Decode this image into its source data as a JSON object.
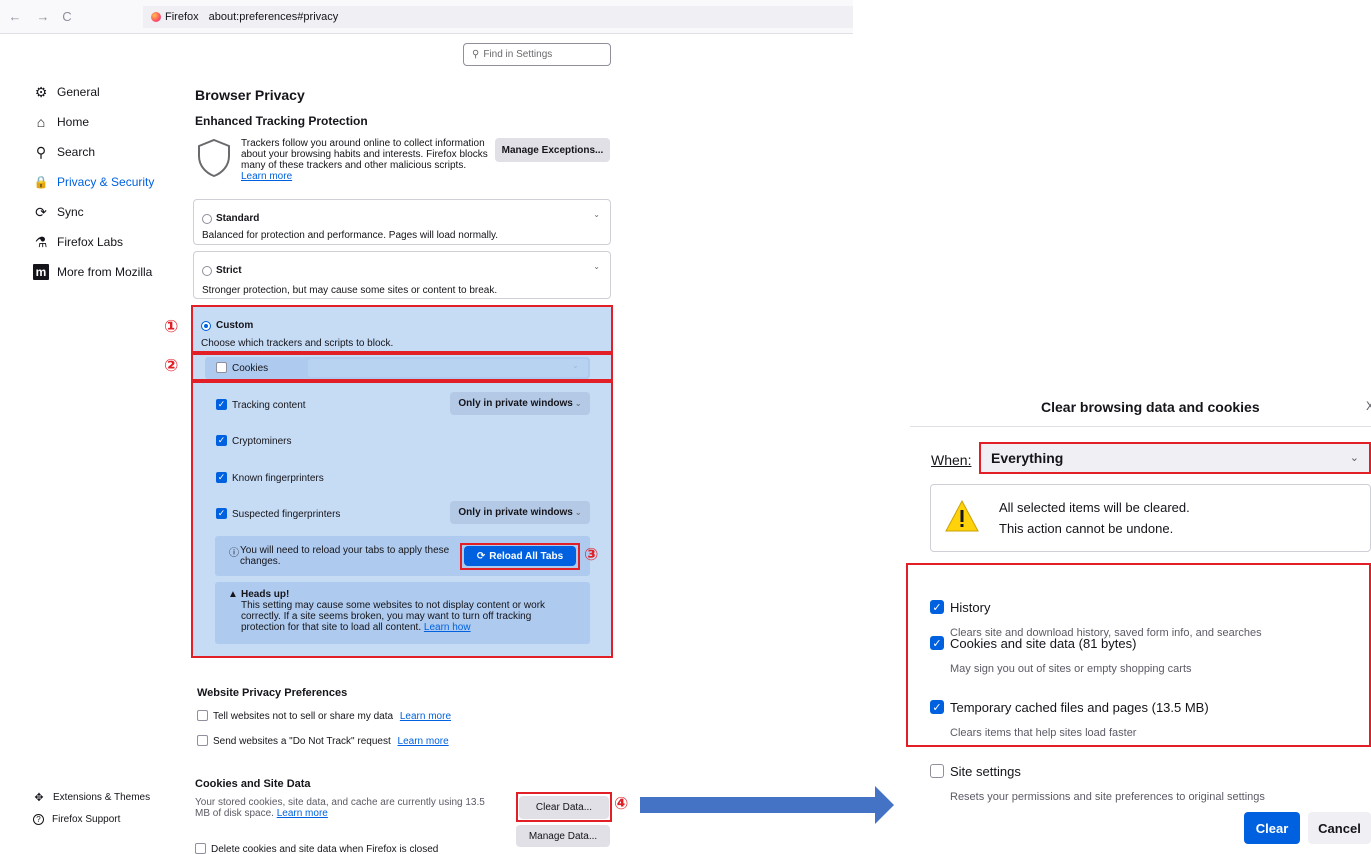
{
  "browser": {
    "back": "←",
    "forward": "→",
    "reload": "C",
    "browser_name": "Firefox",
    "url": "about:preferences#privacy"
  },
  "sidebar": {
    "items": [
      {
        "label": "General",
        "icon": "⚙"
      },
      {
        "label": "Home",
        "icon": "⌂"
      },
      {
        "label": "Search",
        "icon": "⚲"
      },
      {
        "label": "Privacy & Security",
        "icon": "🔒"
      },
      {
        "label": "Sync",
        "icon": "⟳"
      },
      {
        "label": "Firefox Labs",
        "icon": "⚗"
      },
      {
        "label": "More from Mozilla",
        "icon": "m"
      }
    ],
    "footer": [
      {
        "label": "Extensions & Themes",
        "icon": "✥"
      },
      {
        "label": "Firefox Support",
        "icon": "?"
      }
    ]
  },
  "search": {
    "placeholder": "Find in Settings"
  },
  "privacy": {
    "title": "Browser Privacy",
    "etp_title": "Enhanced Tracking Protection",
    "etp_desc": "Trackers follow you around online to collect information about your browsing habits and interests. Firefox blocks many of these trackers and other malicious scripts.",
    "learn_more": "Learn more",
    "manage_exceptions": "Manage Exceptions...",
    "standard": {
      "label": "Standard",
      "desc": "Balanced for protection and performance. Pages will load normally."
    },
    "strict": {
      "label": "Strict",
      "desc": "Stronger protection, but may cause some sites or content to break."
    },
    "custom": {
      "label": "Custom",
      "desc": "Choose which trackers and scripts to block."
    },
    "options": {
      "cookies": "Cookies",
      "tracking": "Tracking content",
      "cryptominers": "Cryptominers",
      "known_fp": "Known fingerprinters",
      "suspected_fp": "Suspected fingerprinters",
      "only_private": "Only in private windows"
    },
    "reload_notice": "You will need to reload your tabs to apply these changes.",
    "reload_button": "Reload All Tabs",
    "headsup_title": "Heads up!",
    "headsup_text": "This setting may cause some websites to not display content or work correctly. If a site seems broken, you may want to turn off tracking protection for that site to load all content.",
    "learn_how": "Learn how"
  },
  "website_prefs": {
    "title": "Website Privacy Preferences",
    "sell": "Tell websites not to sell or share my data",
    "dnt": "Send websites a \"Do Not Track\" request",
    "learn_more": "Learn more"
  },
  "cookies_section": {
    "title": "Cookies and Site Data",
    "desc": "Your stored cookies, site data, and cache are currently using 13.5 MB of disk space.",
    "learn_more": "Learn more",
    "clear_data": "Clear Data...",
    "manage_data": "Manage Data...",
    "delete_on_close": "Delete cookies and site data when Firefox is closed"
  },
  "markers": [
    "①",
    "②",
    "③",
    "④"
  ],
  "dialog": {
    "title": "Clear browsing data and cookies",
    "close": "X",
    "when_label": "When:",
    "when_value": "Everything",
    "warning_line1": "All selected items will be cleared.",
    "warning_line2": "This action cannot be undone.",
    "items": [
      {
        "label": "History",
        "desc": "Clears site and download history, saved form info, and searches",
        "checked": true
      },
      {
        "label": "Cookies and site data (81 bytes)",
        "desc": "May sign you out of sites or empty shopping carts",
        "checked": true
      },
      {
        "label": "Temporary cached files and pages (13.5 MB)",
        "desc": "Clears items that help sites load faster",
        "checked": true
      },
      {
        "label": "Site settings",
        "desc": "Resets your permissions and site preferences to original settings",
        "checked": false
      }
    ],
    "clear": "Clear",
    "cancel": "Cancel"
  },
  "colors": {
    "accent": "#0061e0",
    "annotation_red": "#e21f26",
    "arrow_blue": "#4472c4"
  }
}
